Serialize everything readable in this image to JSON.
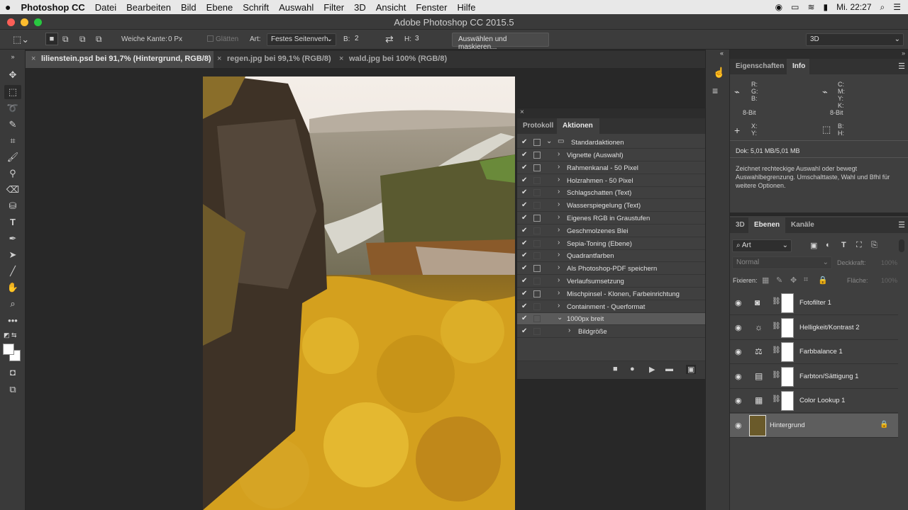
{
  "menubar": {
    "apple": "",
    "app_name": "Photoshop CC",
    "items": [
      "Datei",
      "Bearbeiten",
      "Bild",
      "Ebene",
      "Schrift",
      "Auswahl",
      "Filter",
      "3D",
      "Ansicht",
      "Fenster",
      "Hilfe"
    ],
    "clock": "Mi. 22:27"
  },
  "window": {
    "title": "Adobe Photoshop CC 2015.5"
  },
  "options": {
    "feather_label": "Weiche Kante:",
    "feather_value": "0 Px",
    "antialias_label": "Glätten",
    "style_label": "Art:",
    "style_value": "Festes Seitenverh.",
    "width_label": "B:",
    "width_value": "2",
    "swap_icon": "⇄",
    "height_label": "H:",
    "height_value": "3",
    "select_mask_button": "Auswählen und maskieren...",
    "workspace": "3D"
  },
  "tabs": [
    {
      "label": "lilienstein.psd bei 91,7% (Hintergrund, RGB/8)",
      "active": true
    },
    {
      "label": "regen.jpg bei 99,1% (RGB/8)",
      "active": false
    },
    {
      "label": "wald.jpg bei 100% (RGB/8)",
      "active": false
    }
  ],
  "actions_panel": {
    "tabs": [
      "Protokoll",
      "Aktionen"
    ],
    "active_tab": "Aktionen",
    "set_name": "Standardaktionen",
    "rows": [
      {
        "label": "Vignette (Auswahl)",
        "dialog": true
      },
      {
        "label": "Rahmenkanal - 50 Pixel",
        "dialog": true
      },
      {
        "label": "Holzrahmen - 50 Pixel",
        "dialog": false
      },
      {
        "label": "Schlagschatten (Text)",
        "dialog": false
      },
      {
        "label": "Wasserspiegelung (Text)",
        "dialog": false
      },
      {
        "label": "Eigenes RGB in Graustufen",
        "dialog": true
      },
      {
        "label": "Geschmolzenes Blei",
        "dialog": false
      },
      {
        "label": "Sepia-Toning (Ebene)",
        "dialog": false
      },
      {
        "label": "Quadrantfarben",
        "dialog": false
      },
      {
        "label": "Als Photoshop-PDF speichern",
        "dialog": true
      },
      {
        "label": "Verlaufsumsetzung",
        "dialog": false
      },
      {
        "label": "Mischpinsel - Klonen, Farbeinrichtung",
        "dialog": true
      },
      {
        "label": "Containment - Querformat",
        "dialog": false
      }
    ],
    "selected_action": "1000px breit",
    "step": "Bildgröße"
  },
  "info_panel": {
    "tabs": [
      "Eigenschaften",
      "Info"
    ],
    "active_tab": "Info",
    "rgb_labels": "R:\nG:\nB:",
    "cmyk_labels": "C:\nM:\nY:\nK:",
    "bit_left": "8-Bit",
    "bit_right": "8-Bit",
    "xy_labels": "X:\nY:",
    "bh_labels": "B:\nH:",
    "doc": "Dok: 5,01 MB/5,01 MB",
    "hint": "Zeichnet rechteckige Auswahl oder bewegt Auswahlbegrenzung. Umschalttaste, Wahl und Bfhl für weitere Optionen."
  },
  "layers_panel": {
    "tabs": [
      "3D",
      "Ebenen",
      "Kanäle"
    ],
    "active_tab": "Ebenen",
    "filter": "Art",
    "blend_mode": "Normal",
    "opacity_label": "Deckkraft:",
    "opacity_value": "100%",
    "lock_label": "Fixieren:",
    "fill_label": "Fläche:",
    "fill_value": "100%",
    "layers": [
      {
        "name": "Fotofilter 1",
        "icon": "camera-icon",
        "glyph": "◙"
      },
      {
        "name": "Helligkeit/Kontrast 2",
        "icon": "sun-icon",
        "glyph": "☼"
      },
      {
        "name": "Farbbalance 1",
        "icon": "scale-icon",
        "glyph": "⚖"
      },
      {
        "name": "Farbton/Sättigung 1",
        "icon": "hue-icon",
        "glyph": "▤"
      },
      {
        "name": "Color Lookup 1",
        "icon": "grid-icon",
        "glyph": "▦"
      }
    ],
    "background_layer": "Hintergrund"
  }
}
